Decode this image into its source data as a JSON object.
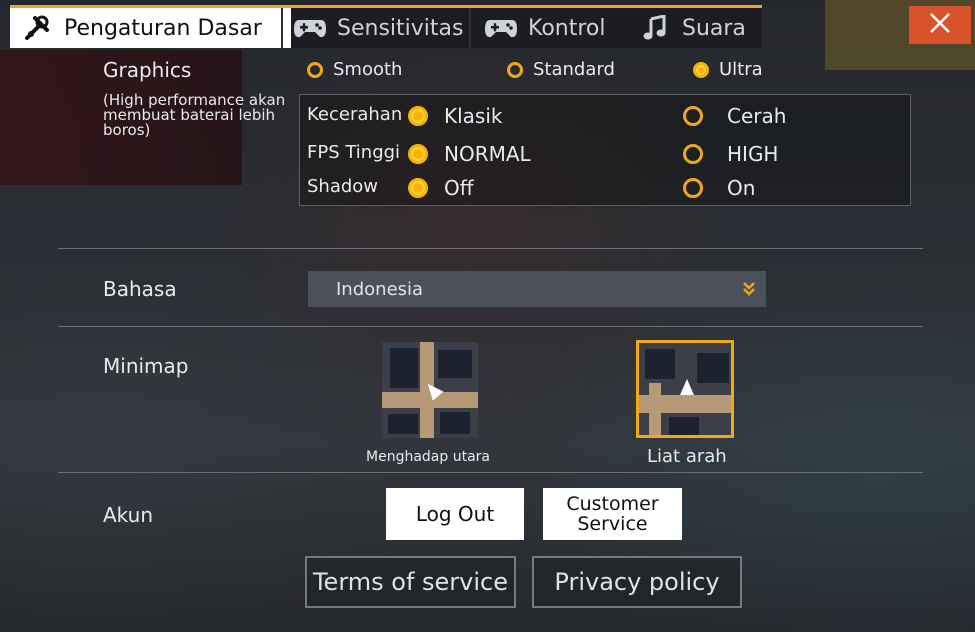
{
  "tabs": [
    {
      "label": "Pengaturan Dasar",
      "icon": "wrench-icon",
      "active": true
    },
    {
      "label": "Sensitivitas",
      "icon": "gamepad-icon",
      "active": false
    },
    {
      "label": "Kontrol",
      "icon": "gamepad-icon",
      "active": false
    },
    {
      "label": "Suara",
      "icon": "music-note-icon",
      "active": false
    }
  ],
  "close_icon": "close-icon",
  "graphics": {
    "label": "Graphics",
    "note": "(High performance akan membuat baterai lebih boros)",
    "options": [
      "Smooth",
      "Standard",
      "Ultra"
    ],
    "selected": "Ultra"
  },
  "kecerahan": {
    "label": "Kecerahan",
    "options": [
      "Klasik",
      "Cerah"
    ],
    "selected": "Klasik"
  },
  "fps": {
    "label": "FPS Tinggi",
    "options": [
      "NORMAL",
      "HIGH"
    ],
    "selected": "NORMAL"
  },
  "shadow": {
    "label": "Shadow",
    "options": [
      "Off",
      "On"
    ],
    "selected": "Off"
  },
  "bahasa": {
    "label": "Bahasa",
    "value": "Indonesia"
  },
  "minimap": {
    "label": "Minimap",
    "options": [
      "Menghadap utara",
      "Liat arah"
    ],
    "selected": "Liat arah"
  },
  "akun": {
    "label": "Akun",
    "logout": "Log Out",
    "customer_service": "Customer Service"
  },
  "footer": {
    "terms": "Terms of service",
    "privacy": "Privacy policy"
  },
  "colors": {
    "accent": "#f0a81a",
    "close": "#d8532c",
    "tab_highlight": "#e7a72d"
  }
}
